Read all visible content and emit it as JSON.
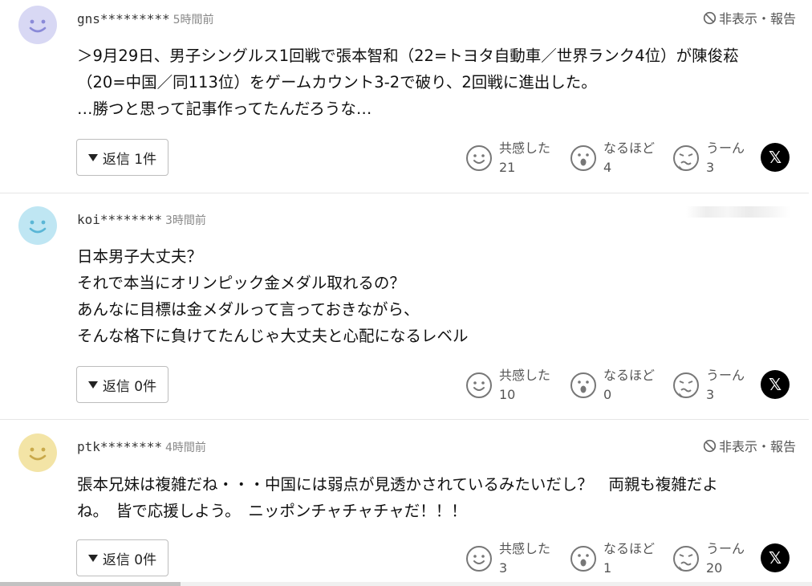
{
  "comments": [
    {
      "user": "gns*********",
      "time": "5時間前",
      "avatar_color": "#d8d8f4",
      "avatar_face": "#8a8ad8",
      "report_label": "非表示・報告",
      "lines": [
        "＞9月29日、男子シングルス1回戦で張本智和（22=トヨタ自動車／世界ランク4位）が陳俊菘",
        "（20=中国／同113位）をゲームカウント3-2で破り、2回戦に進出した。",
        "…勝つと思って記事作ってたんだろうな…"
      ],
      "reply_label": "返信 1件",
      "reactions": {
        "agree_label": "共感した",
        "agree_count": "21",
        "insight_label": "なるほど",
        "insight_count": "4",
        "hmm_label": "うーん",
        "hmm_count": "3"
      }
    },
    {
      "user": "koi********",
      "time": "3時間前",
      "avatar_color": "#bfe6f3",
      "avatar_face": "#5ab6d6",
      "lines": [
        "日本男子大丈夫？",
        "それで本当にオリンピック金メダル取れるの？",
        "あんなに目標は金メダルって言っておきながら、",
        "そんな格下に負けてたんじゃ大丈夫と心配になるレベル"
      ],
      "reply_label": "返信 0件",
      "reactions": {
        "agree_label": "共感した",
        "agree_count": "10",
        "insight_label": "なるほど",
        "insight_count": "0",
        "hmm_label": "うーん",
        "hmm_count": "3"
      }
    },
    {
      "user": "ptk********",
      "time": "4時間前",
      "avatar_color": "#f3e4a6",
      "avatar_face": "#c9a94a",
      "report_label": "非表示・報告",
      "lines": [
        "張本兄妹は複雑だね・・・中国には弱点が見透かされているみたいだし？　両親も複雑だよ",
        "ね。　皆で応援しよう。　ニッポンチャチャチャだ！！！"
      ],
      "reply_label": "返信 0件",
      "reactions": {
        "agree_label": "共感した",
        "agree_count": "3",
        "insight_label": "なるほど",
        "insight_count": "1",
        "hmm_label": "うーん",
        "hmm_count": "20"
      }
    }
  ],
  "share_label": "𝕏",
  "icons": {
    "report": "block-icon",
    "agree": "smile-face-icon",
    "insight": "surprised-face-icon",
    "hmm": "confused-face-icon",
    "share": "x-logo-icon"
  }
}
